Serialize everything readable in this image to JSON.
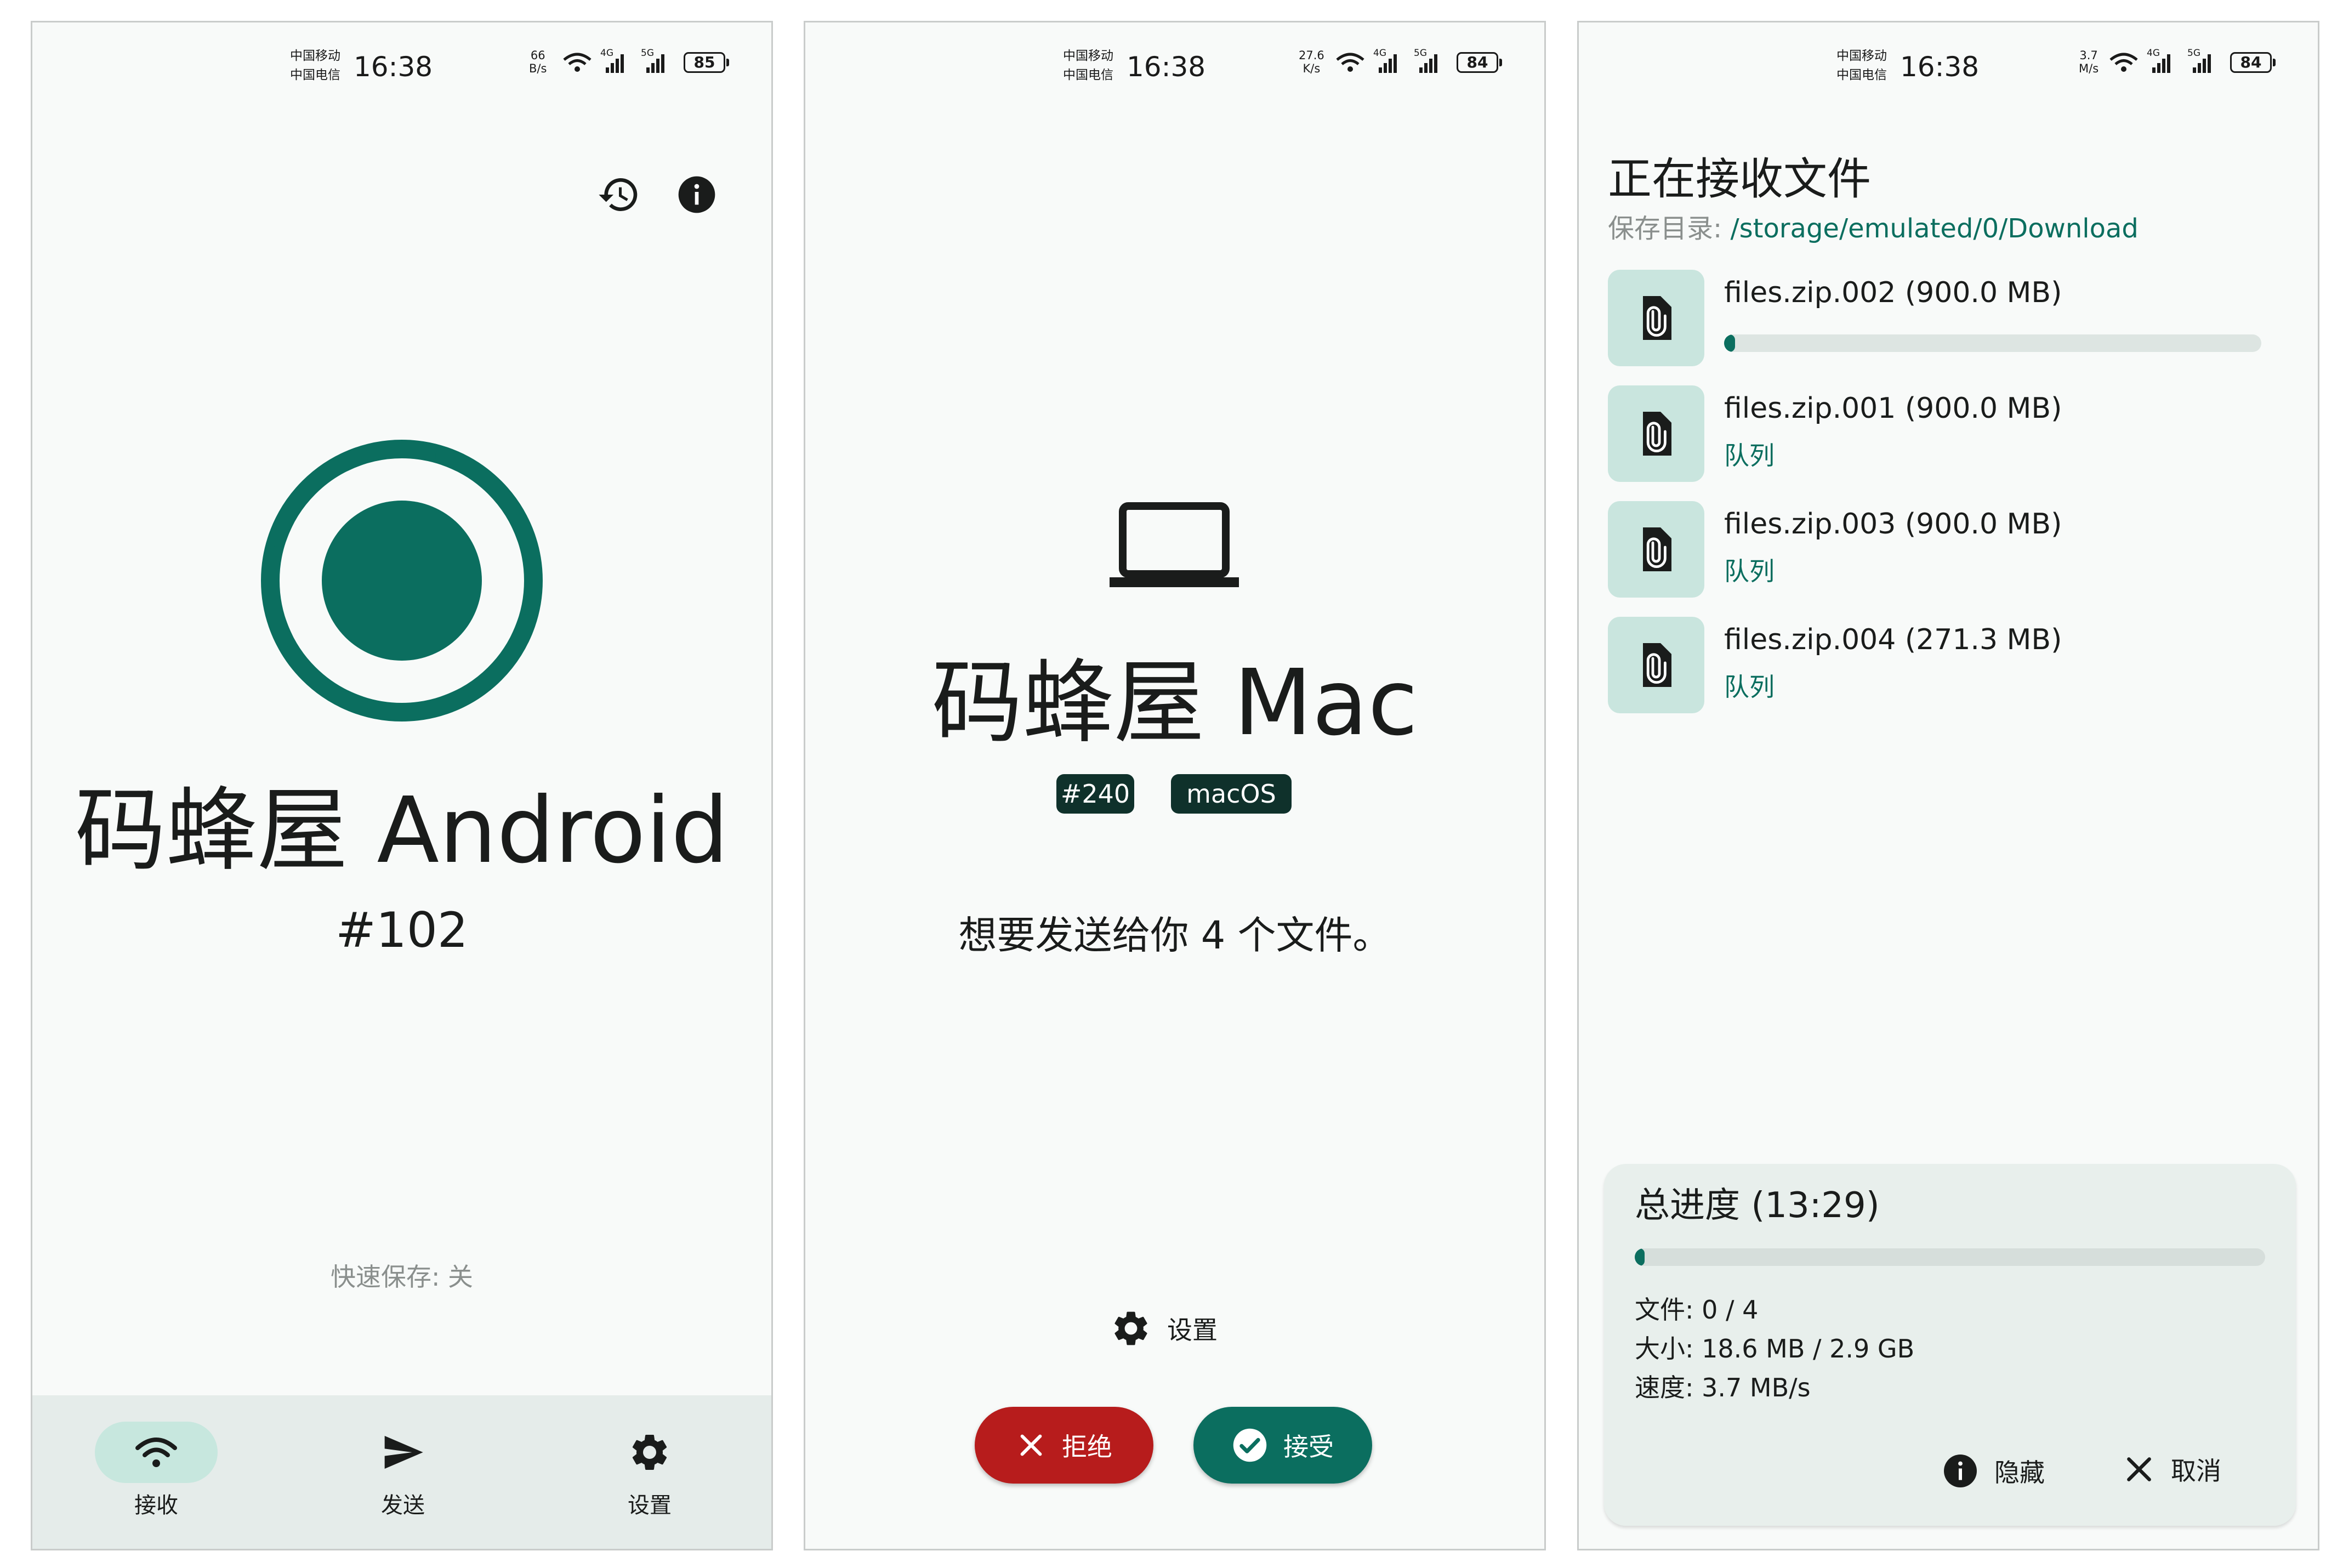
{
  "colors": {
    "accent": "#0b6e5f",
    "accent_light": "#c9e5de",
    "nav_bg": "#e5ecea",
    "tag_bg": "#0f312b",
    "reject": "#b71c1c",
    "accept": "#0b6e5f",
    "muted": "#8a8f8d"
  },
  "screen1": {
    "status": {
      "carrier1": "中国移动",
      "carrier2": "中国电信",
      "time": "16:38",
      "speed_value": "66",
      "speed_unit": "B/s",
      "net1": "4G",
      "net2": "5G",
      "battery": "85"
    },
    "icons": {
      "history": "history-icon",
      "info": "info-icon"
    },
    "device_name": "码蜂屋 Android",
    "device_id": "#102",
    "quick_save": "快速保存: 关",
    "nav": [
      {
        "label": "接收",
        "icon": "wifi-icon",
        "active": true
      },
      {
        "label": "发送",
        "icon": "send-icon",
        "active": false
      },
      {
        "label": "设置",
        "icon": "gear-icon",
        "active": false
      }
    ]
  },
  "screen2": {
    "status": {
      "carrier1": "中国移动",
      "carrier2": "中国电信",
      "time": "16:38",
      "speed_value": "27.6",
      "speed_unit": "K/s",
      "net1": "4G",
      "net2": "5G",
      "battery": "84"
    },
    "device_icon": "laptop-icon",
    "device_name": "码蜂屋 Mac",
    "tags": [
      "#240",
      "macOS"
    ],
    "message": "想要发送给你 4 个文件。",
    "settings_label": "设置",
    "reject_label": "拒绝",
    "accept_label": "接受"
  },
  "screen3": {
    "status": {
      "carrier1": "中国移动",
      "carrier2": "中国电信",
      "time": "16:38",
      "speed_value": "3.7",
      "speed_unit": "M/s",
      "net1": "4G",
      "net2": "5G",
      "battery": "84"
    },
    "title": "正在接收文件",
    "save_dir_label": "保存目录: ",
    "save_dir_path": "/storage/emulated/0/Download",
    "files": [
      {
        "name": "files.zip.002 (900.0 MB)",
        "status": "",
        "progress": 0.02
      },
      {
        "name": "files.zip.001 (900.0 MB)",
        "status": "队列"
      },
      {
        "name": "files.zip.003 (900.0 MB)",
        "status": "队列"
      },
      {
        "name": "files.zip.004 (271.3 MB)",
        "status": "队列"
      }
    ],
    "summary": {
      "title": "总进度 (13:29)",
      "progress": 0.006,
      "files_label": "文件: ",
      "files_value": "0 / 4",
      "size_label": "大小: ",
      "size_value": "18.6 MB / 2.9 GB",
      "speed_label": "速度: ",
      "speed_value": "3.7 MB/s",
      "hide_label": "隐藏",
      "cancel_label": "取消"
    }
  }
}
